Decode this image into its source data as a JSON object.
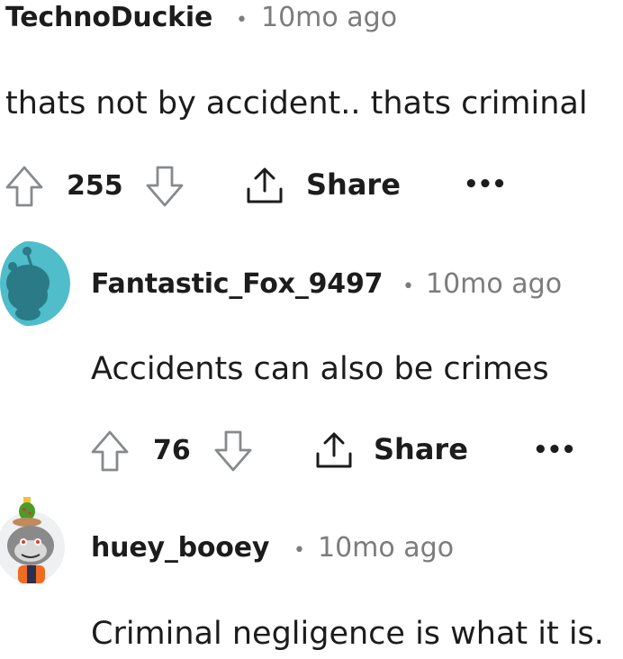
{
  "comments": [
    {
      "username": "TechnoDuckie",
      "separator": "•",
      "time": "10mo ago",
      "text": "thats not by accident.. thats criminal",
      "votes": "255",
      "share_label": "Share",
      "more": "•••"
    },
    {
      "username": "Fantastic_Fox_9497",
      "separator": "•",
      "time": "10mo ago",
      "text": "Accidents can also be crimes",
      "votes": "76",
      "share_label": "Share",
      "more": "•••",
      "avatar_color": "#4fbdca"
    },
    {
      "username": "huey_booey",
      "separator": "•",
      "time": "10mo ago",
      "text": "Criminal negligence is what it is."
    }
  ],
  "colors": {
    "text": "#1c1c1c",
    "meta": "#7c7c7c",
    "icon": "#878a8c"
  }
}
